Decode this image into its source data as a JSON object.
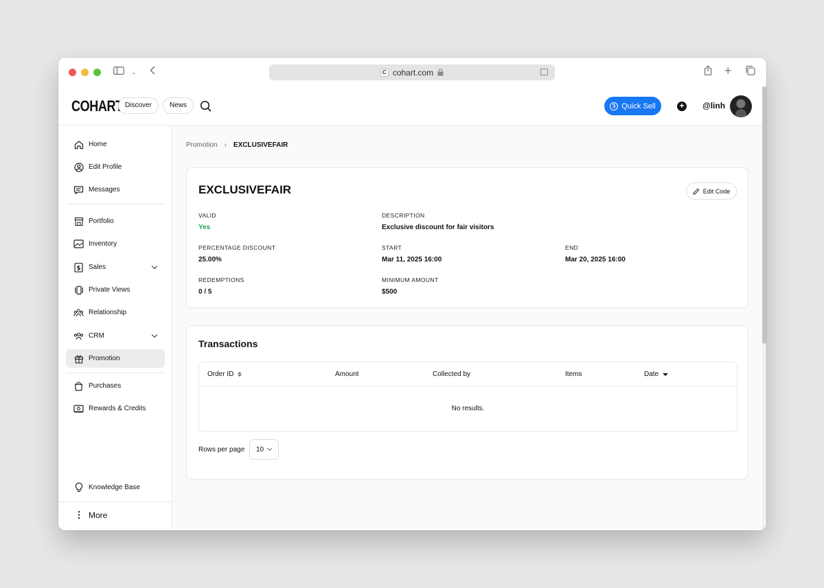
{
  "browser": {
    "url": "cohart.com"
  },
  "header": {
    "logo": "COHART",
    "nav": [
      "Discover",
      "News"
    ],
    "quick_sell_label": "Quick Sell",
    "username": "@linh"
  },
  "sidebar": {
    "items": [
      {
        "label": "Home",
        "icon": "home-icon"
      },
      {
        "label": "Edit Profile",
        "icon": "user-circle-icon"
      },
      {
        "label": "Messages",
        "icon": "message-icon"
      },
      {
        "label": "Portfolio",
        "icon": "storefront-icon"
      },
      {
        "label": "Inventory",
        "icon": "image-icon"
      },
      {
        "label": "Sales",
        "icon": "dollar-icon"
      },
      {
        "label": "Private Views",
        "icon": "cards-icon"
      },
      {
        "label": "Relationship",
        "icon": "people-icon"
      },
      {
        "label": "CRM",
        "icon": "group-icon"
      },
      {
        "label": "Promotion",
        "icon": "gift-icon"
      },
      {
        "label": "Purchases",
        "icon": "bag-icon"
      },
      {
        "label": "Rewards & Credits",
        "icon": "ticket-icon"
      },
      {
        "label": "Knowledge Base",
        "icon": "lightbulb-icon"
      },
      {
        "label": "More",
        "icon": "dots-icon"
      }
    ],
    "active": "Promotion"
  },
  "breadcrumb": {
    "parent": "Promotion",
    "separator": "›",
    "current": "EXCLUSIVEFAIR"
  },
  "promo": {
    "title": "EXCLUSIVEFAIR",
    "edit_label": "Edit Code",
    "fields": {
      "valid": {
        "label": "VALID",
        "value": "Yes"
      },
      "description": {
        "label": "DESCRIPTION",
        "value": "Exclusive discount for fair visitors"
      },
      "percentage": {
        "label": "PERCENTAGE DISCOUNT",
        "value": "25.00%"
      },
      "start": {
        "label": "START",
        "value": "Mar 11, 2025 16:00"
      },
      "end": {
        "label": "END",
        "value": "Mar 20, 2025 16:00"
      },
      "redemptions": {
        "label": "REDEMPTIONS",
        "value": "0 / 5"
      },
      "minimum": {
        "label": "MINIMUM AMOUNT",
        "value": "$500"
      }
    }
  },
  "transactions": {
    "title": "Transactions",
    "columns": [
      "Order ID",
      "Amount",
      "Collected by",
      "Items",
      "Date"
    ],
    "empty_text": "No results.",
    "rows_per_page_label": "Rows per page",
    "rows_per_page_value": "10"
  },
  "colors": {
    "accent": "#1877f2",
    "valid_green": "#22a64a"
  }
}
